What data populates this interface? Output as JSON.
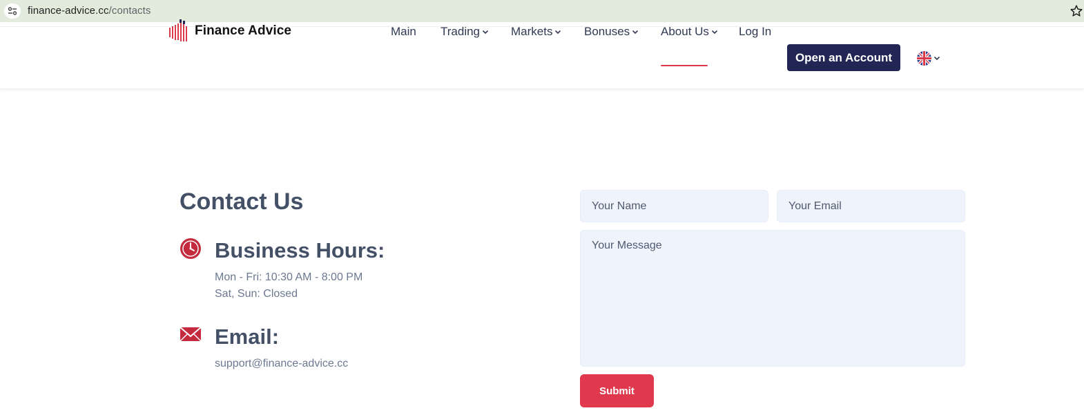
{
  "browser": {
    "url_domain": "finance-advice.cc",
    "url_path": "/contacts",
    "site_info_icon": "tune-icon",
    "bookmark_icon": "star-icon"
  },
  "header": {
    "logo_text": "Finance Advice",
    "nav": [
      {
        "label": "Main"
      },
      {
        "label": "Trading",
        "dropdown": true
      },
      {
        "label": "Markets",
        "dropdown": true
      },
      {
        "label": "Bonuses",
        "dropdown": true
      },
      {
        "label": "About Us",
        "dropdown": true,
        "active": true
      },
      {
        "label": "Log In"
      }
    ],
    "cta_label": "Open an Account",
    "language": "uk-flag-icon"
  },
  "contact": {
    "title": "Contact Us",
    "hours": {
      "heading": "Business Hours:",
      "lines": [
        "Mon - Fri: 10:30 AM - 8:00 PM",
        "Sat, Sun: Closed"
      ],
      "icon": "clock-icon"
    },
    "email": {
      "heading": "Email:",
      "address": "support@finance-advice.cc",
      "icon": "envelope-icon"
    }
  },
  "form": {
    "name_placeholder": "Your Name",
    "email_placeholder": "Your Email",
    "message_placeholder": "Your Message",
    "submit_label": "Submit"
  },
  "colors": {
    "accent": "#e0384c",
    "cta": "#222654",
    "heading": "#445066",
    "field_bg": "#eff4fc",
    "urlbar_bg": "#e3ecdc"
  }
}
